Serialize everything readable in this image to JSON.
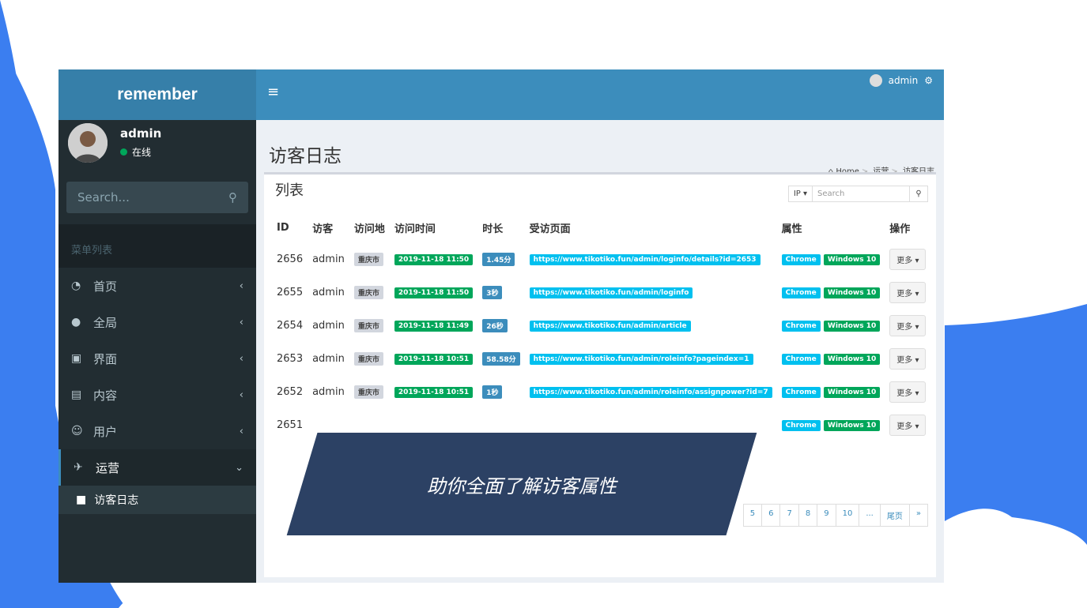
{
  "app": {
    "logo": "remember"
  },
  "user": {
    "name": "admin",
    "status": "在线"
  },
  "sidebar": {
    "search_placeholder": "Search...",
    "menu_header": "菜单列表",
    "items": [
      {
        "label": "首页",
        "icon": "dashboard-icon"
      },
      {
        "label": "全局",
        "icon": "globe-icon"
      },
      {
        "label": "界面",
        "icon": "desktop-icon"
      },
      {
        "label": "内容",
        "icon": "file-icon"
      },
      {
        "label": "用户",
        "icon": "users-icon"
      },
      {
        "label": "运营",
        "icon": "plane-icon"
      }
    ],
    "submenu": {
      "label": "访客日志",
      "icon": "folder-icon"
    }
  },
  "header": {
    "menu_icon": "≡",
    "user": "admin",
    "page_title": "访客日志",
    "breadcrumb": [
      "Home",
      "运营",
      "访客日志"
    ]
  },
  "box": {
    "title": "列表",
    "filter": "IP ▾",
    "search_placeholder": "Search",
    "columns": [
      "ID",
      "访客",
      "访问地",
      "访问时间",
      "时长",
      "受访页面",
      "属性",
      "操作"
    ]
  },
  "rows": [
    {
      "id": "2656",
      "visitor": "admin",
      "place": "重庆市",
      "time": "2019-11-18 11:50",
      "duration": "1.45分",
      "page": "https://www.tikotiko.fun/admin/loginfo/details?id=2653",
      "browser": "Chrome",
      "os": "Windows 10",
      "action": "更多 ▾"
    },
    {
      "id": "2655",
      "visitor": "admin",
      "place": "重庆市",
      "time": "2019-11-18 11:50",
      "duration": "3秒",
      "page": "https://www.tikotiko.fun/admin/loginfo",
      "browser": "Chrome",
      "os": "Windows 10",
      "action": "更多 ▾"
    },
    {
      "id": "2654",
      "visitor": "admin",
      "place": "重庆市",
      "time": "2019-11-18 11:49",
      "duration": "26秒",
      "page": "https://www.tikotiko.fun/admin/article",
      "browser": "Chrome",
      "os": "Windows 10",
      "action": "更多 ▾"
    },
    {
      "id": "2653",
      "visitor": "admin",
      "place": "重庆市",
      "time": "2019-11-18 10:51",
      "duration": "58.58分",
      "page": "https://www.tikotiko.fun/admin/roleinfo?pageindex=1",
      "browser": "Chrome",
      "os": "Windows 10",
      "action": "更多 ▾"
    },
    {
      "id": "2652",
      "visitor": "admin",
      "place": "重庆市",
      "time": "2019-11-18 10:51",
      "duration": "1秒",
      "page": "https://www.tikotiko.fun/admin/roleinfo/assignpower?id=7",
      "browser": "Chrome",
      "os": "Windows 10",
      "action": "更多 ▾"
    },
    {
      "id": "2651",
      "visitor": "",
      "place": "",
      "time": "",
      "duration": "",
      "page": "",
      "browser": "Chrome",
      "os": "Windows 10",
      "action": "更多 ▾"
    }
  ],
  "pager": [
    "5",
    "6",
    "7",
    "8",
    "9",
    "10",
    "...",
    "尾页",
    "»"
  ],
  "banner": {
    "text": "助你全面了解访客属性"
  },
  "colors": {
    "primary": "#3c8dbc",
    "bg_blue": "#3b82f6",
    "banner": "#2c4164"
  }
}
